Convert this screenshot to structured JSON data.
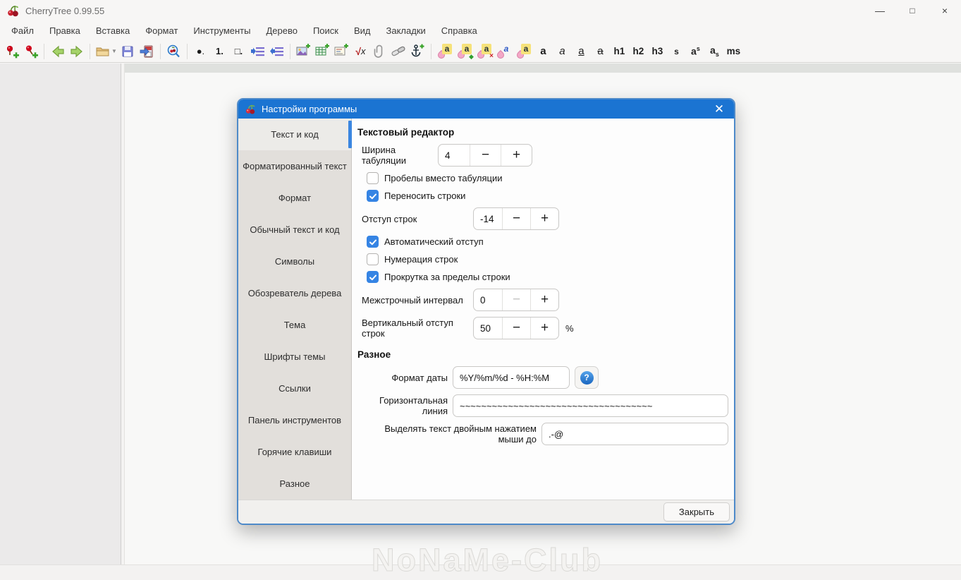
{
  "window": {
    "title": "CherryTree 0.99.55",
    "controls": {
      "minimize": "—",
      "maximize": "□",
      "close": "×"
    }
  },
  "menubar": {
    "items": [
      "Файл",
      "Правка",
      "Вставка",
      "Формат",
      "Инструменты",
      "Дерево",
      "Поиск",
      "Вид",
      "Закладки",
      "Справка"
    ]
  },
  "toolbar": {
    "bullet_list": "●.",
    "numbered_list": "1.",
    "todo_list": "□.",
    "formula_sqrt": "√",
    "formula_var": "x",
    "color_letters": [
      "a",
      "a",
      "a",
      "a",
      "a"
    ],
    "bold": "a",
    "italic": "a",
    "underline": "a",
    "strikethrough": "a",
    "h1": "h1",
    "h2": "h2",
    "h3": "h3",
    "small": "s",
    "sup_base": "a",
    "sup_mark": "s",
    "sub_base": "a",
    "sub_mark": "s",
    "monospace": "ms"
  },
  "ui": {
    "dropdown_arrow": "▼",
    "minus": "−",
    "plus": "+",
    "mark_apply": "◆",
    "mark_clear": "×",
    "help_glyph": "?",
    "dialog_close": "✕"
  },
  "dialog": {
    "title": "Настройки программы",
    "tabs": [
      {
        "label": "Текст и код",
        "selected": true
      },
      {
        "label": "Форматированный текст",
        "selected": false
      },
      {
        "label": "Формат",
        "selected": false
      },
      {
        "label": "Обычный текст и код",
        "selected": false
      },
      {
        "label": "Символы",
        "selected": false
      },
      {
        "label": "Обозреватель дерева",
        "selected": false
      },
      {
        "label": "Тема",
        "selected": false
      },
      {
        "label": "Шрифты темы",
        "selected": false
      },
      {
        "label": "Ссылки",
        "selected": false
      },
      {
        "label": "Панель инструментов",
        "selected": false
      },
      {
        "label": "Горячие клавиши",
        "selected": false
      },
      {
        "label": "Разное",
        "selected": false
      }
    ],
    "editor": {
      "heading": "Текстовый редактор",
      "tab_width": {
        "label": "Ширина табуляции",
        "value": "4"
      },
      "spaces_instead_tabs": {
        "label": "Пробелы вместо табуляции",
        "checked": false
      },
      "line_wrap": {
        "label": "Переносить строки",
        "checked": true
      },
      "line_indent": {
        "label": "Отступ строк",
        "value": "-14"
      },
      "auto_indent": {
        "label": "Автоматический отступ",
        "checked": true
      },
      "line_numbers": {
        "label": "Нумерация строк",
        "checked": false
      },
      "scroll_beyond": {
        "label": "Прокрутка за пределы строки",
        "checked": true
      },
      "line_spacing": {
        "label": "Межстрочный интервал",
        "value": "0"
      },
      "vertical_offset": {
        "label": "Вертикальный отступ строк",
        "value": "50",
        "unit": "%"
      }
    },
    "misc": {
      "heading": "Разное",
      "date_format": {
        "label": "Формат даты",
        "value": "%Y/%m/%d - %H:%M"
      },
      "horizontal_rule": {
        "label": "Горизонтальная линия",
        "value": "~~~~~~~~~~~~~~~~~~~~~~~~~~~~~~~~~~~~"
      },
      "double_click_select": {
        "label": "Выделять текст двойным нажатием мыши до",
        "value": ".-@"
      }
    },
    "close_button": "Закрыть"
  },
  "watermark": {
    "text": "NoNaMe-Club"
  },
  "colors": {
    "dialog_titlebar": "#1b74d2",
    "dialog_border": "#4e8ac9",
    "checkbox_checked": "#3584e4",
    "tab_indicator": "#3a86e0",
    "toolbar_green": "#a6d36a",
    "cherry_red": "#c91f2e"
  }
}
